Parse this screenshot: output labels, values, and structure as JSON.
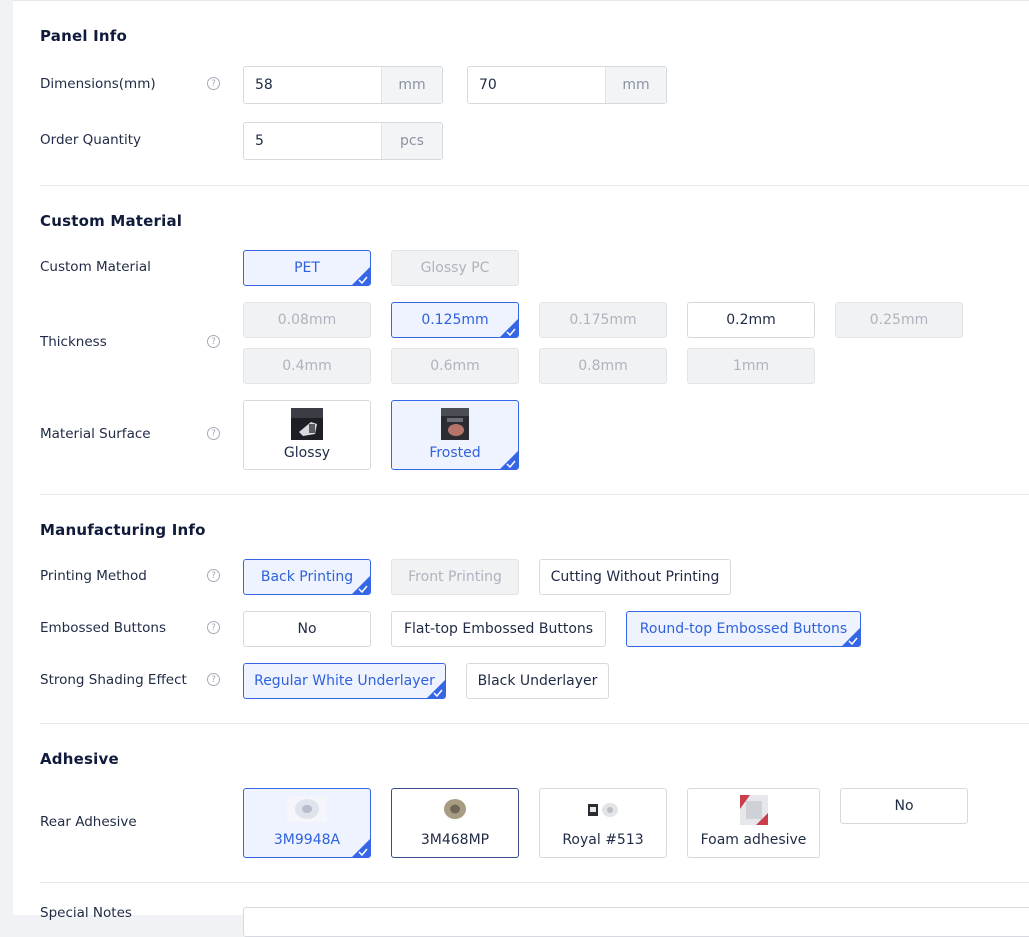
{
  "colors": {
    "accent": "#3466e6",
    "selected_bg": "#eef3ff",
    "disabled_bg": "#f1f2f4"
  },
  "help_glyph": "?",
  "panel_info": {
    "title": "Panel Info",
    "dimensions_label": "Dimensions(mm)",
    "width_value": "58",
    "height_value": "70",
    "dim_unit": "mm",
    "quantity_label": "Order Quantity",
    "quantity_value": "5",
    "quantity_unit": "pcs"
  },
  "custom_material": {
    "title": "Custom Material",
    "material_label": "Custom Material",
    "materials": [
      {
        "label": "PET",
        "state": "selected"
      },
      {
        "label": "Glossy PC",
        "state": "disabled"
      }
    ],
    "thickness_label": "Thickness",
    "thickness": [
      {
        "label": "0.08mm",
        "state": "disabled"
      },
      {
        "label": "0.125mm",
        "state": "selected"
      },
      {
        "label": "0.175mm",
        "state": "disabled"
      },
      {
        "label": "0.2mm",
        "state": "normal"
      },
      {
        "label": "0.25mm",
        "state": "disabled"
      },
      {
        "label": "0.4mm",
        "state": "disabled"
      },
      {
        "label": "0.6mm",
        "state": "disabled"
      },
      {
        "label": "0.8mm",
        "state": "disabled"
      },
      {
        "label": "1mm",
        "state": "disabled"
      }
    ],
    "surface_label": "Material Surface",
    "surfaces": [
      {
        "label": "Glossy",
        "state": "normal"
      },
      {
        "label": "Frosted",
        "state": "selected"
      }
    ]
  },
  "manufacturing": {
    "title": "Manufacturing Info",
    "printing_label": "Printing Method",
    "printing": [
      {
        "label": "Back Printing",
        "state": "selected"
      },
      {
        "label": "Front Printing",
        "state": "disabled"
      },
      {
        "label": "Cutting Without Printing",
        "state": "normal"
      }
    ],
    "embossed_label": "Embossed Buttons",
    "embossed": [
      {
        "label": "No",
        "state": "normal"
      },
      {
        "label": "Flat-top Embossed Buttons",
        "state": "normal"
      },
      {
        "label": "Round-top Embossed Buttons",
        "state": "selected"
      }
    ],
    "shading_label": "Strong Shading Effect",
    "shading": [
      {
        "label": "Regular White Underlayer",
        "state": "selected"
      },
      {
        "label": "Black Underlayer",
        "state": "normal"
      }
    ]
  },
  "adhesive": {
    "title": "Adhesive",
    "rear_label": "Rear Adhesive",
    "options": [
      {
        "label": "3M9948A",
        "state": "selected"
      },
      {
        "label": "3M468MP",
        "state": "outlined"
      },
      {
        "label": "Royal #513",
        "state": "normal"
      },
      {
        "label": "Foam adhesive",
        "state": "normal"
      },
      {
        "label": "No",
        "state": "normal"
      }
    ]
  },
  "notes": {
    "label": "Special Notes"
  }
}
